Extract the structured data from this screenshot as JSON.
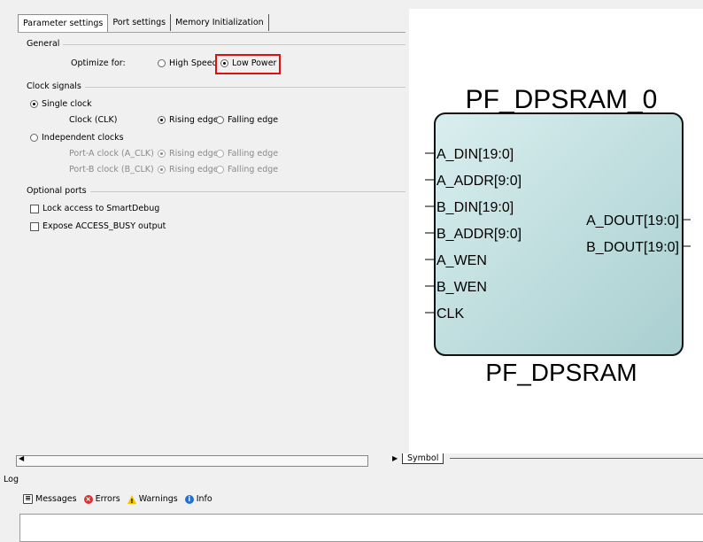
{
  "tabs": [
    "Parameter settings",
    "Port settings",
    "Memory Initialization"
  ],
  "general": {
    "section_label": "General",
    "optimize_label": "Optimize for:",
    "options": [
      "High Speed",
      "Low Power"
    ],
    "selected": "Low Power"
  },
  "clock": {
    "section_label": "Clock signals",
    "single_clock_label": "Single clock",
    "clk_label": "Clock (CLK)",
    "independent_label": "Independent clocks",
    "port_a_label": "Port-A clock (A_CLK)",
    "port_b_label": "Port-B clock (B_CLK)",
    "rising": "Rising edge",
    "falling": "Falling edge"
  },
  "optional": {
    "section_label": "Optional ports",
    "lock_label": "Lock access to SmartDebug",
    "busy_label": "Expose  ACCESS_BUSY output"
  },
  "symbol": {
    "instance_name": "PF_DPSRAM_0",
    "component_name": "PF_DPSRAM",
    "inputs": [
      "A_DIN[19:0]",
      "A_ADDR[9:0]",
      "B_DIN[19:0]",
      "B_ADDR[9:0]",
      "A_WEN",
      "B_WEN",
      "CLK"
    ],
    "outputs": [
      "A_DOUT[19:0]",
      "B_DOUT[19:0]"
    ],
    "tab_label": "Symbol"
  },
  "log": {
    "title": "Log",
    "tabs": [
      "Messages",
      "Errors",
      "Warnings",
      "Info"
    ]
  },
  "colors": {
    "highlight": "#e01010",
    "block_fill_start": "#d9eeef",
    "block_fill_end": "#a9cfd0"
  }
}
